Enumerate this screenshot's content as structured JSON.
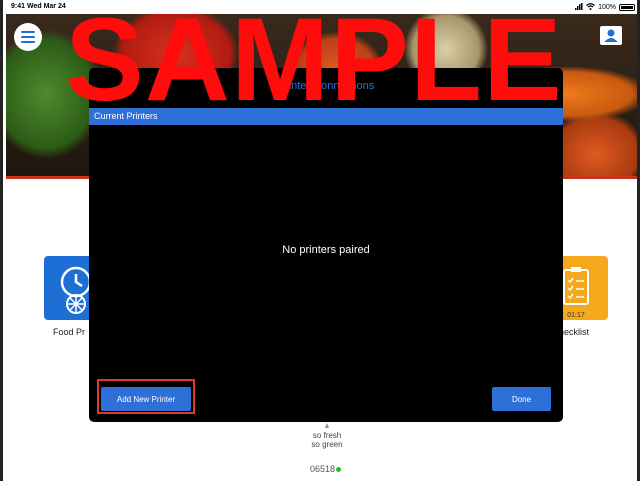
{
  "status_bar": {
    "time": "9:41",
    "date": "Wed Mar 24",
    "battery": "100%"
  },
  "header": {
    "menu_icon": "hamburger-icon",
    "user_icon": "user-icon"
  },
  "tiles": [
    {
      "label": "Food Pr",
      "icon": "clock-icon",
      "color": "#1d6fd6"
    },
    {
      "label": "hecklist",
      "icon": "clipboard-icon",
      "color": "#f5a81c",
      "time": "01:17"
    }
  ],
  "modal": {
    "title": "Printer Connections",
    "section_header": "Current Printers",
    "empty_message": "No printers paired",
    "add_button_label": "Add New Printer",
    "done_button_label": "Done",
    "accent_color": "#2f6fd8",
    "highlight_color": "#e23a2a"
  },
  "footer": {
    "logo_line1": "so fresh",
    "logo_line2": "so green",
    "store_code": "06518",
    "status_color": "#21c12b"
  },
  "watermark": "SAMPLE"
}
